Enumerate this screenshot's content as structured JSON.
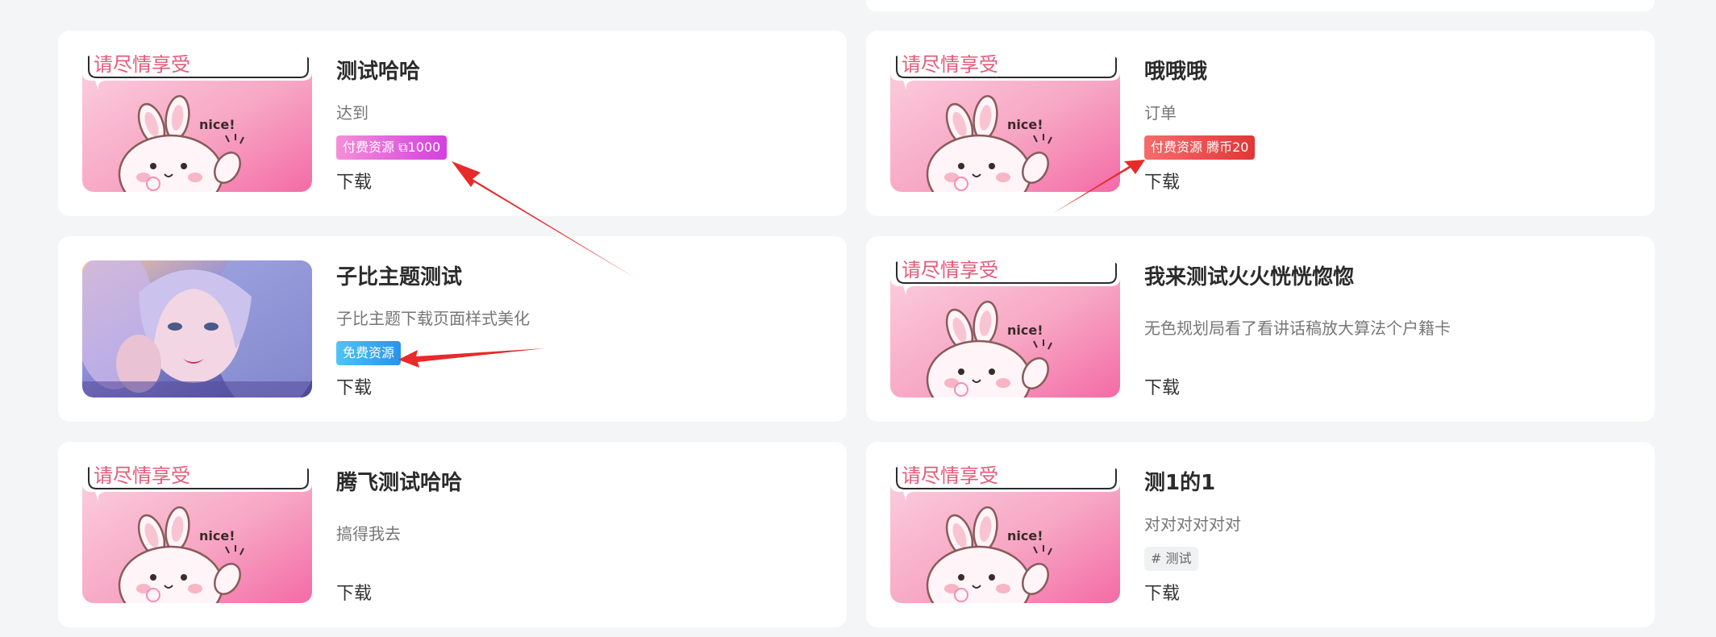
{
  "banner_text": "请尽情享受",
  "banner_nice": "nice!",
  "cards": [
    {
      "title": "测试哈哈",
      "desc": "达到",
      "badge": "付费资源 ⧉1000",
      "download": "下载"
    },
    {
      "title": "哦哦哦",
      "desc": "订单",
      "badge": "付费资源 腾币20",
      "download": "下载"
    },
    {
      "title": "子比主题测试",
      "desc": "子比主题下载页面样式美化",
      "badge": "免费资源",
      "download": "下载"
    },
    {
      "title": "我来测试火火恍恍惚惚",
      "desc": "无色规划局看了看讲话稿放大算法个户籍卡",
      "download": "下载"
    },
    {
      "title": "腾飞测试哈哈",
      "desc": "搞得我去",
      "download": "下载"
    },
    {
      "title": "测1的1",
      "desc": "对对对对对对",
      "tag": "# 测试",
      "download": "下载"
    }
  ],
  "colors": {
    "background": "#f4f5f7",
    "card": "#ffffff",
    "annotation_arrow": "#e82a2a"
  }
}
